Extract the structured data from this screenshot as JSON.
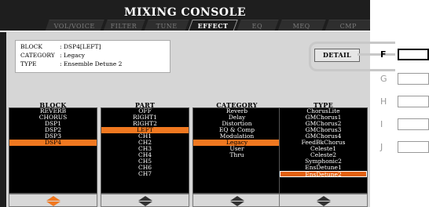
{
  "title": "MIXING CONSOLE",
  "tabs": [
    "VOL/VOICE",
    "FILTER",
    "TUNE",
    "EFFECT",
    "EQ",
    "MEQ",
    "CMP"
  ],
  "active_tab": "EFFECT",
  "info": {
    "block_key": "BLOCK",
    "block_val": ": DSP4[LEFT]",
    "category_key": "CATEGORY",
    "category_val": ": Legacy",
    "type_key": "TYPE",
    "type_val": ": Ensemble Detune 2"
  },
  "detail_button": "DETAIL",
  "columns": {
    "block": {
      "header": "BLOCK",
      "items": [
        "REVERB",
        "CHORUS",
        "DSP1",
        "DSP2",
        "DSP3",
        "DSP4"
      ],
      "selected": 5
    },
    "part": {
      "header": "PART",
      "items": [
        "OFF",
        "RIGHT1",
        "RIGHT2",
        "LEFT",
        "CH1",
        "CH2",
        "CH3",
        "CH4",
        "CH5",
        "CH6",
        "CH7"
      ],
      "selected": 3
    },
    "category": {
      "header": "CATEGORY",
      "items": [
        "Reverb",
        "Delay",
        "Distortion",
        "EQ & Comp",
        "Modulation",
        "Legacy",
        "User",
        "Thru"
      ],
      "selected": 5
    },
    "type": {
      "header": "TYPE",
      "items": [
        "ChorusLite",
        "GMChorus1",
        "GMChorus2",
        "GMChorus3",
        "GMChorus4",
        "FeedBkChorus",
        "Celeste1",
        "Celeste2",
        "Symphonic2",
        "EnsDetune1",
        "EnsDetune2"
      ],
      "selected": 10
    }
  },
  "function_keys": [
    "F",
    "G",
    "H",
    "I",
    "J"
  ],
  "active_function_key": "F",
  "colors": {
    "accent": "#f07820",
    "screen_bg": "#1e1e1e",
    "panel_bg": "#d6d6d6"
  }
}
